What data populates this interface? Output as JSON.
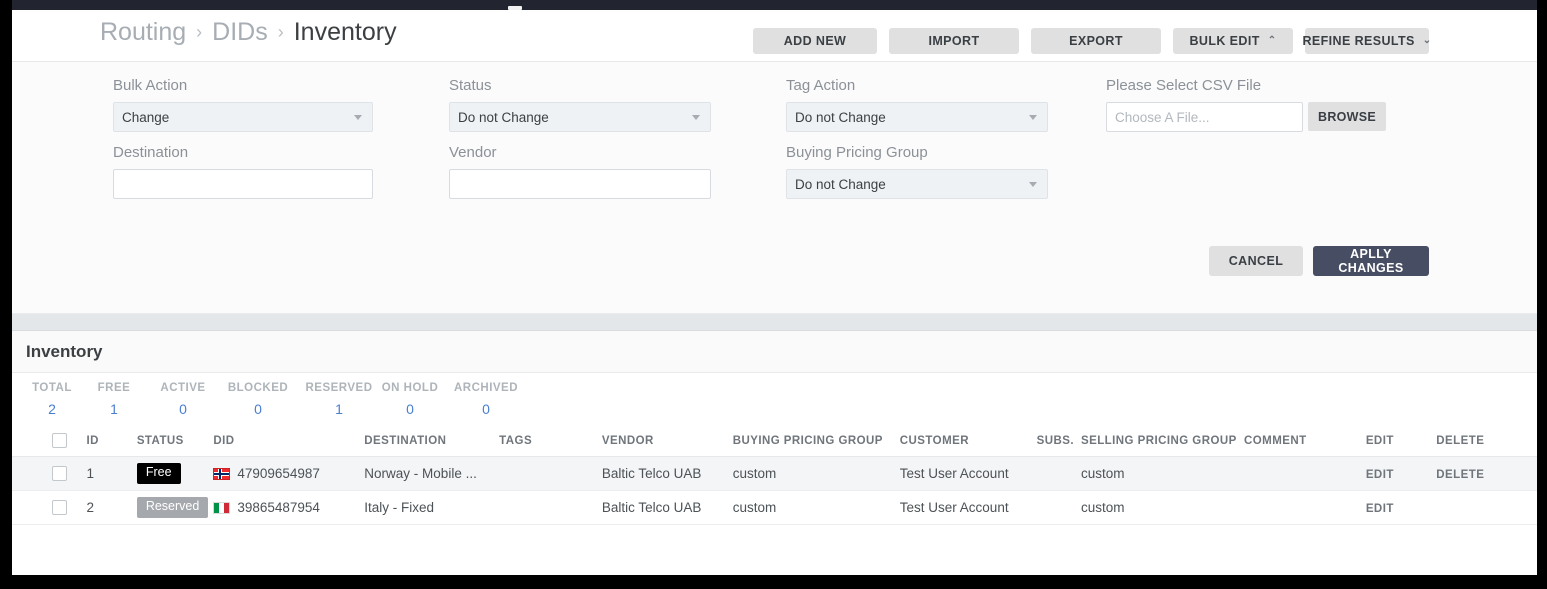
{
  "breadcrumb": {
    "items": [
      {
        "label": "Routing",
        "current": false
      },
      {
        "label": "DIDs",
        "current": false
      },
      {
        "label": "Inventory",
        "current": true
      }
    ],
    "separator": "›"
  },
  "header_actions": {
    "add_new": "ADD NEW",
    "import": "IMPORT",
    "export": "EXPORT",
    "bulk_edit": "BULK EDIT",
    "bulk_edit_caret": "⌃",
    "refine_results": "REFINE RESULTS",
    "refine_results_caret": "⌄"
  },
  "bulk_panel": {
    "bulk_action": {
      "label": "Bulk Action",
      "value": "Change"
    },
    "status": {
      "label": "Status",
      "value": "Do not Change"
    },
    "tag_action": {
      "label": "Tag Action",
      "value": "Do not Change"
    },
    "csv_file": {
      "label": "Please Select CSV File",
      "placeholder": "Choose A File...",
      "value": "",
      "browse_label": "BROWSE"
    },
    "destination": {
      "label": "Destination",
      "value": ""
    },
    "vendor": {
      "label": "Vendor",
      "value": ""
    },
    "buying_pricing_group": {
      "label": "Buying Pricing Group",
      "value": "Do not Change"
    },
    "cancel_label": "CANCEL",
    "apply_label": "APLLY CHANGES"
  },
  "inventory": {
    "title": "Inventory",
    "stats": [
      {
        "key": "TOTAL",
        "value": "2"
      },
      {
        "key": "FREE",
        "value": "1"
      },
      {
        "key": "ACTIVE",
        "value": "0"
      },
      {
        "key": "BLOCKED",
        "value": "0"
      },
      {
        "key": "RESERVED",
        "value": "1"
      },
      {
        "key": "ON HOLD",
        "value": "0"
      },
      {
        "key": "ARCHIVED",
        "value": "0"
      }
    ],
    "columns": [
      "",
      "ID",
      "STATUS",
      "DID",
      "DESTINATION",
      "TAGS",
      "VENDOR",
      "BUYING PRICING GROUP",
      "CUSTOMER",
      "SUBS.",
      "SELLING PRICING GROUP",
      "COMMENT",
      "EDIT",
      "DELETE"
    ],
    "rows": [
      {
        "id": "1",
        "status": "Free",
        "status_kind": "free",
        "flag": "norway-flag-icon",
        "did": "47909654987",
        "destination": "Norway - Mobile ...",
        "tags": "",
        "vendor": "Baltic Telco UAB",
        "buying_pricing_group": "custom",
        "customer": "Test User Account",
        "subs": "",
        "selling_pricing_group": "custom",
        "comment": "",
        "edit": "EDIT",
        "delete": "DELETE"
      },
      {
        "id": "2",
        "status": "Reserved",
        "status_kind": "reserved",
        "flag": "italy-flag-icon",
        "did": "39865487954",
        "destination": "Italy - Fixed",
        "tags": "",
        "vendor": "Baltic Telco UAB",
        "buying_pricing_group": "custom",
        "customer": "Test User Account",
        "subs": "",
        "selling_pricing_group": "custom",
        "comment": "",
        "edit": "EDIT",
        "delete": ""
      }
    ]
  },
  "colors": {
    "accent_blue": "#4a7fd0",
    "apply_button": "#474d63",
    "badge_free": "#000000",
    "badge_reserved": "#a5a9ad",
    "chrome": "#22252f"
  }
}
